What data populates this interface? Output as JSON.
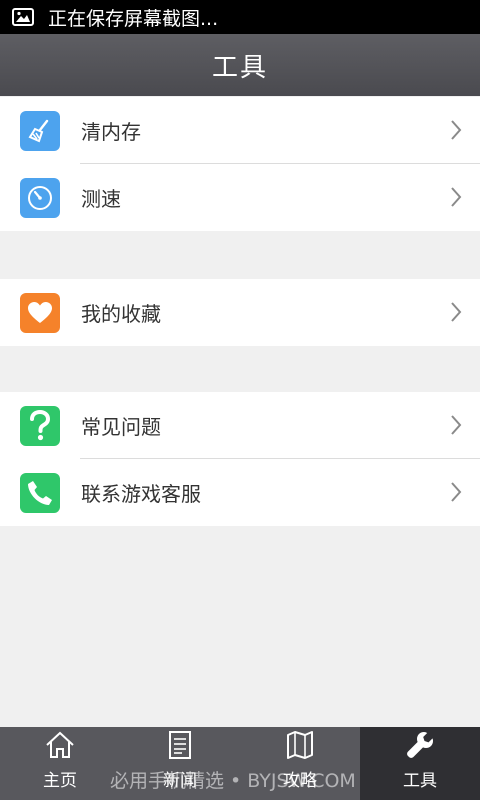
{
  "status_bar": {
    "text": "正在保存屏幕截图..."
  },
  "header": {
    "title": "工具"
  },
  "groups": [
    {
      "items": [
        {
          "label": "清内存",
          "icon": "broom-icon",
          "color": "#4da3ee"
        },
        {
          "label": "测速",
          "icon": "speedometer-icon",
          "color": "#4da3ee"
        }
      ]
    },
    {
      "items": [
        {
          "label": "我的收藏",
          "icon": "heart-icon",
          "color": "#f5822a"
        }
      ]
    },
    {
      "items": [
        {
          "label": "常见问题",
          "icon": "question-icon",
          "color": "#2fc76a"
        },
        {
          "label": "联系游戏客服",
          "icon": "phone-icon",
          "color": "#2fc76a"
        }
      ]
    }
  ],
  "tabbar": {
    "tabs": [
      {
        "label": "主页",
        "icon": "home-icon"
      },
      {
        "label": "新闻",
        "icon": "news-icon"
      },
      {
        "label": "攻略",
        "icon": "map-icon"
      },
      {
        "label": "工具",
        "icon": "wrench-icon",
        "active": true
      }
    ]
  },
  "watermark": "必用手机精选 • BYJSW.COM"
}
